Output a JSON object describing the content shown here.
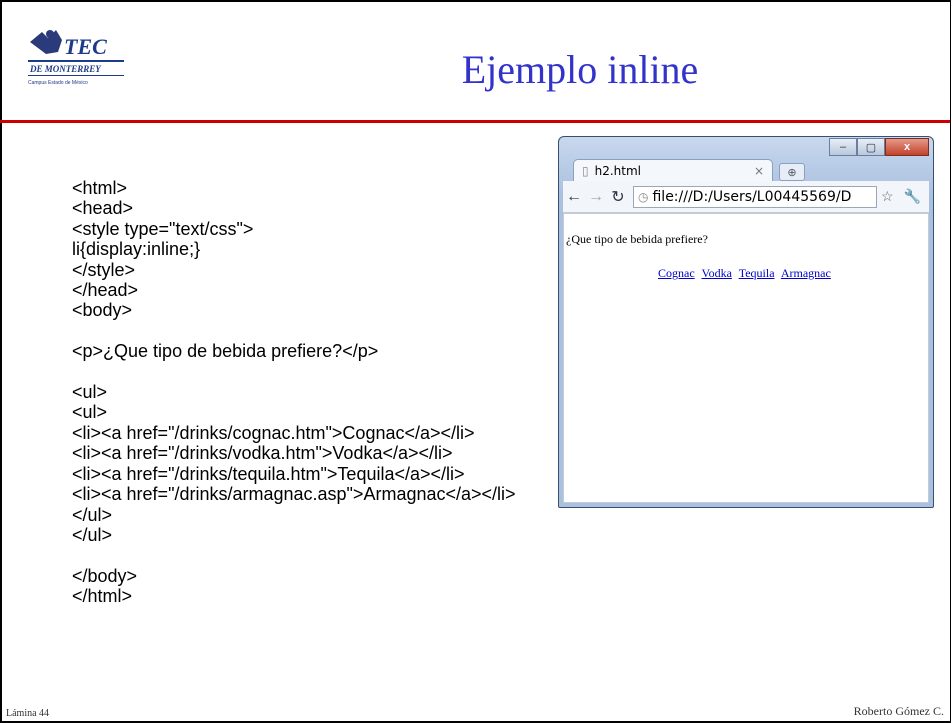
{
  "slide": {
    "title": "Ejemplo inline",
    "logo_text": "TEC",
    "logo_sub1": "DE MONTERREY",
    "logo_sub2": "Campus Estado de México",
    "footer_left": "Lámina 44",
    "footer_right": "Roberto Gómez C."
  },
  "code_lines": [
    "<html>",
    "<head>",
    "<style type=\"text/css\">",
    "li{display:inline;}",
    "</style>",
    "</head>",
    "<body>",
    "",
    "<p>¿Que tipo de bebida prefiere?</p>",
    "",
    "<ul>",
    "<ul>",
    "<li><a href=\"/drinks/cognac.htm\">Cognac</a></li>",
    "<li><a href=\"/drinks/vodka.htm\">Vodka</a></li>",
    "<li><a href=\"/drinks/tequila.htm\">Tequila</a></li>",
    "<li><a href=\"/drinks/armagnac.asp\">Armagnac</a></li>",
    "</ul>",
    "</ul>",
    "",
    "</body>",
    "</html>"
  ],
  "browser": {
    "tab_title": "h2.html",
    "tab_close": "×",
    "address": "file:///D:/Users/L00445569/D",
    "paragraph": "¿Que tipo de bebida prefiere?",
    "links": [
      "Cognac",
      "Vodka",
      "Tequila",
      "Armagnac"
    ],
    "buttons": {
      "minimize": "–",
      "maximize": "▢",
      "close": "x"
    }
  }
}
